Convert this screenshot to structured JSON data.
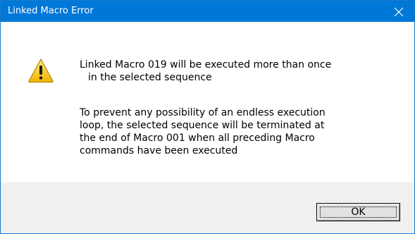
{
  "window": {
    "title": "Linked Macro Error",
    "close_icon": "close-icon",
    "titlebar_color": "#0078d7"
  },
  "message": {
    "icon": "warning-icon",
    "paragraph1": [
      "Linked Macro 019 will be executed more than once",
      "in the selected sequence"
    ],
    "paragraph2": [
      "To prevent any possibility of an endless execution",
      "loop, the selected sequence will be terminated at",
      "the end of Macro 001 when all preceding Macro",
      "commands have been executed"
    ]
  },
  "buttons": {
    "ok_label": "OK"
  }
}
